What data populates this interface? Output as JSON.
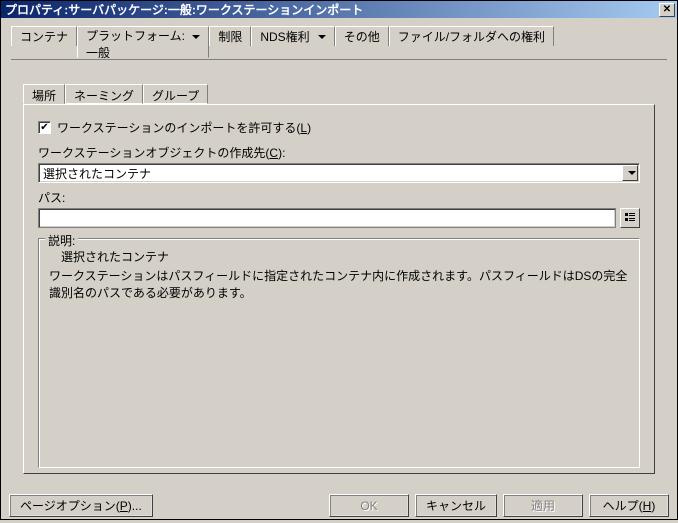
{
  "title": "プロパティ:サーバパッケージ:一般:ワークステーションインポート",
  "top_tabs": {
    "container": "コンテナ",
    "platform": "プラットフォーム: ",
    "platform_sub": "一般",
    "limit": "制限",
    "nds": "NDS権利 ",
    "other": "その他",
    "filefolder": "ファイル/フォルダへの権利"
  },
  "sub_tabs": {
    "location": "場所",
    "naming": "ネーミング",
    "group": "グループ"
  },
  "form": {
    "allow_import_label": "ワークステーションのインポートを許可する(",
    "allow_import_key": "L",
    "allow_import_label2": ")",
    "object_creation_label": "ワークステーションオブジェクトの作成先(",
    "object_creation_key": "C",
    "object_creation_label2": "):",
    "select_value": "選択されたコンテナ",
    "path_label": "パス:",
    "path_value": ""
  },
  "description": {
    "title": "説明:",
    "head": "選択されたコンテナ",
    "body": "ワークステーションはパスフィールドに指定されたコンテナ内に作成されます。パスフィールドはDSの完全識別名のパスである必要があります。"
  },
  "buttons": {
    "page_options_pre": "ページオプション(",
    "page_options_key": "P",
    "page_options_post": ")...",
    "ok": "OK",
    "cancel": "キャンセル",
    "apply": "適用",
    "help_pre": "ヘルプ(",
    "help_key": "H",
    "help_post": ")"
  }
}
